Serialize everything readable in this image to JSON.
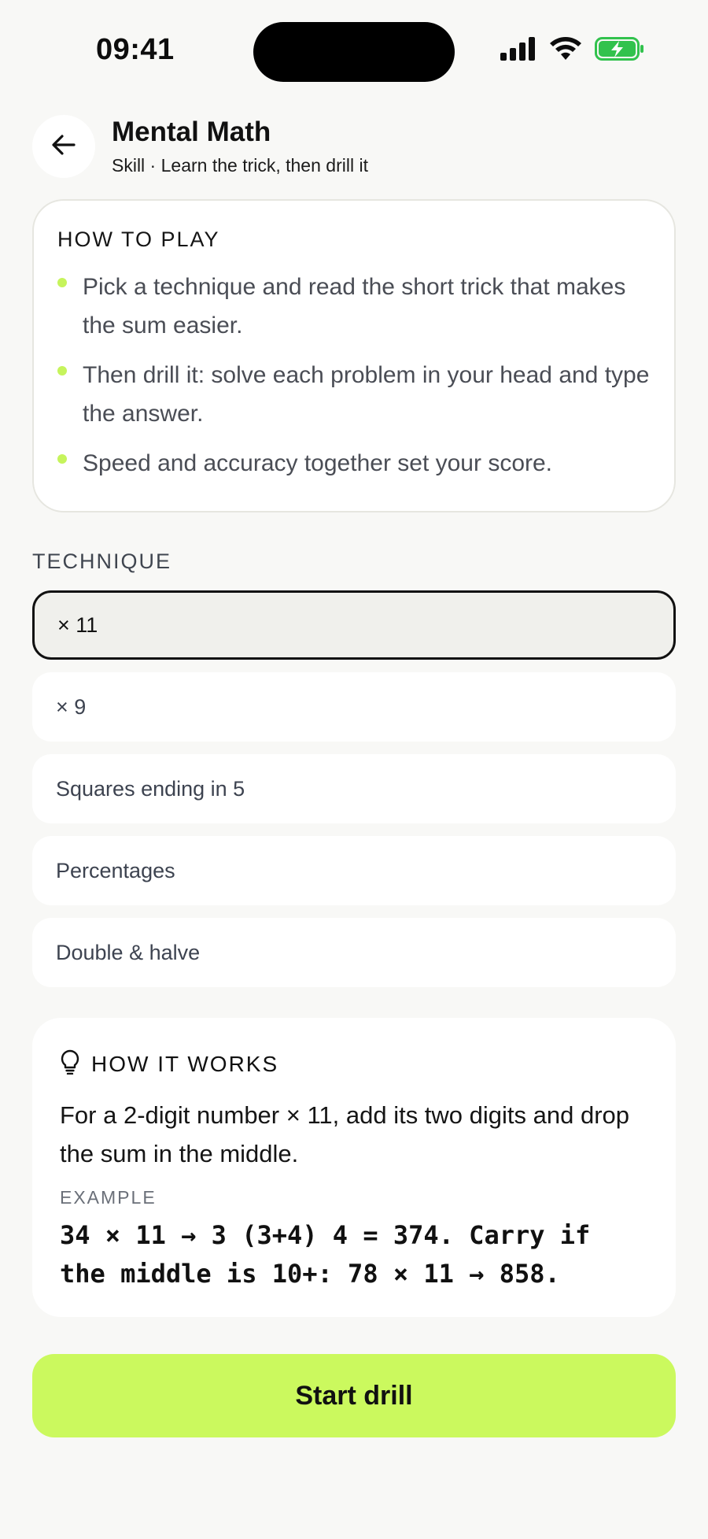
{
  "status_bar": {
    "time": "09:41",
    "icons": [
      "signal-icon",
      "wifi-icon",
      "battery-charging-icon"
    ],
    "battery_color": "#32c24d"
  },
  "header": {
    "back_icon": "arrow-left-icon",
    "title": "Mental Math",
    "subtitle": "Skill · Learn the trick, then drill it"
  },
  "how_to_play": {
    "heading": "HOW TO PLAY",
    "rules": [
      "Pick a technique and read the short trick that makes the sum easier.",
      "Then drill it: solve each problem in your head and type the answer.",
      "Speed and accuracy together set your score."
    ],
    "bullet_color": "#c6f45c"
  },
  "technique": {
    "label": "TECHNIQUE",
    "options": [
      {
        "label": "× 11",
        "selected": true
      },
      {
        "label": "× 9",
        "selected": false
      },
      {
        "label": "Squares ending in 5",
        "selected": false
      },
      {
        "label": "Percentages",
        "selected": false
      },
      {
        "label": "Double & halve",
        "selected": false
      }
    ]
  },
  "how_it_works": {
    "icon": "lightbulb-icon",
    "heading": "HOW IT WORKS",
    "body": "For a 2-digit number × 11, add its two digits and drop the sum in the middle.",
    "example_label": "EXAMPLE",
    "example": "34 × 11 → 3 (3+4) 4 = 374. Carry if the middle is 10+: 78 × 11 → 858."
  },
  "start_button": {
    "label": "Start drill",
    "color": "#cbf95e"
  }
}
